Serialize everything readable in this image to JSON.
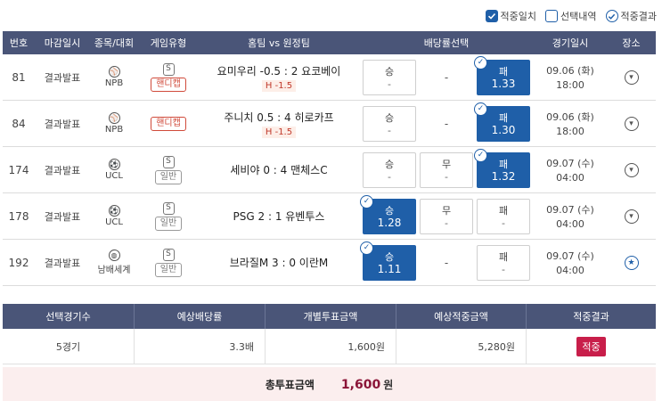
{
  "legend": {
    "hit_label": "적중일치",
    "selected_label": "선택내역",
    "result_label": "적중결과"
  },
  "columns": {
    "num": "번호",
    "deadline": "마감일시",
    "league": "종목/대회",
    "type": "게임유형",
    "match": "홈팀 vs 원정팀",
    "odds": "배당률선택",
    "time": "경기일시",
    "venue": "장소"
  },
  "rows": [
    {
      "num": "81",
      "deadline": "결과발표",
      "league": "NPB",
      "sport": "baseball",
      "type_code": "S",
      "type": "핸디캡",
      "type_style": "handicap",
      "match": "요미우리 -0.5 : 2 요코베이",
      "handicap": "H -1.5",
      "odds": [
        {
          "label": "승",
          "value": "-",
          "selected": false,
          "boxed": true
        },
        {
          "label": "-",
          "value": "",
          "selected": false,
          "boxed": false
        },
        {
          "label": "패",
          "value": "1.33",
          "selected": true,
          "boxed": true
        }
      ],
      "date": "09.06 (화)",
      "time": "18:00",
      "venue_active": false
    },
    {
      "num": "84",
      "deadline": "결과발표",
      "league": "NPB",
      "sport": "baseball",
      "type_code": "",
      "type": "핸디캡",
      "type_style": "handicap",
      "match": "주니치 0.5 : 4 히로카프",
      "handicap": "H -1.5",
      "odds": [
        {
          "label": "승",
          "value": "-",
          "selected": false,
          "boxed": true
        },
        {
          "label": "-",
          "value": "",
          "selected": false,
          "boxed": false
        },
        {
          "label": "패",
          "value": "1.30",
          "selected": true,
          "boxed": true
        }
      ],
      "date": "09.06 (화)",
      "time": "18:00",
      "venue_active": false
    },
    {
      "num": "174",
      "deadline": "결과발표",
      "league": "UCL",
      "sport": "soccer",
      "type_code": "S",
      "type": "일반",
      "type_style": "normal",
      "match": "세비야 0 : 4 맨체스C",
      "handicap": "",
      "odds": [
        {
          "label": "승",
          "value": "-",
          "selected": false,
          "boxed": true
        },
        {
          "label": "무",
          "value": "-",
          "selected": false,
          "boxed": true
        },
        {
          "label": "패",
          "value": "1.32",
          "selected": true,
          "boxed": true
        }
      ],
      "date": "09.07 (수)",
      "time": "04:00",
      "venue_active": false
    },
    {
      "num": "178",
      "deadline": "결과발표",
      "league": "UCL",
      "sport": "soccer",
      "type_code": "S",
      "type": "일반",
      "type_style": "normal",
      "match": "PSG 2 : 1 유벤투스",
      "handicap": "",
      "odds": [
        {
          "label": "승",
          "value": "1.28",
          "selected": true,
          "boxed": true
        },
        {
          "label": "무",
          "value": "-",
          "selected": false,
          "boxed": true
        },
        {
          "label": "패",
          "value": "-",
          "selected": false,
          "boxed": true
        }
      ],
      "date": "09.07 (수)",
      "time": "04:00",
      "venue_active": false
    },
    {
      "num": "192",
      "deadline": "결과발표",
      "league": "남배세계",
      "sport": "volleyball",
      "type_code": "S",
      "type": "일반",
      "type_style": "normal",
      "match": "브라질M 3 : 0 이란M",
      "handicap": "",
      "odds": [
        {
          "label": "승",
          "value": "1.11",
          "selected": true,
          "boxed": true
        },
        {
          "label": "-",
          "value": "",
          "selected": false,
          "boxed": false
        },
        {
          "label": "패",
          "value": "-",
          "selected": false,
          "boxed": true
        }
      ],
      "date": "09.07 (수)",
      "time": "04:00",
      "venue_active": true
    }
  ],
  "summary": {
    "headers": [
      "선택경기수",
      "예상배당률",
      "개별투표금액",
      "예상적중금액",
      "적중결과"
    ],
    "games": "5경기",
    "odds": "3.3배",
    "stake": "1,600원",
    "expected": "5,280원",
    "result": "적중"
  },
  "total": {
    "label": "총투표금액",
    "amount": "1,600",
    "unit": "원"
  },
  "colors": {
    "header_bg": "#4a5578",
    "selected_bg": "#1f5fa8",
    "hit_badge": "#c81e4a",
    "total_bg": "#fbeeee"
  }
}
